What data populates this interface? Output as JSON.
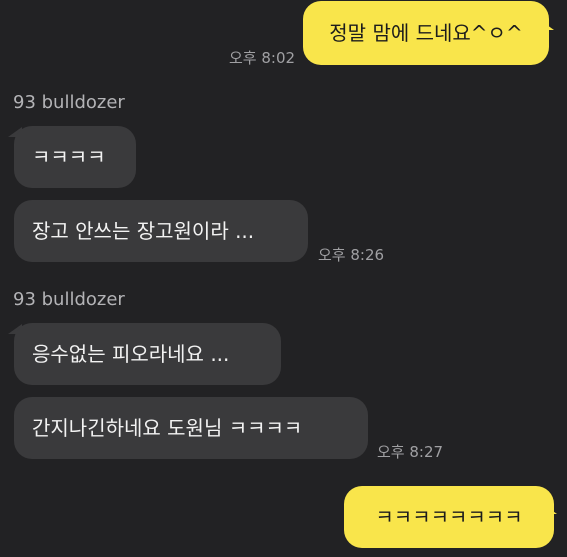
{
  "messages": [
    {
      "direction": "outgoing",
      "text": "정말 맘에 드네요^ㅇ^",
      "time": "오후 8:02"
    },
    {
      "direction": "incoming",
      "sender": "93 bulldozer",
      "text": "ㅋㅋㅋㅋ"
    },
    {
      "direction": "incoming",
      "text": "장고 안쓰는 장고원이라 ...",
      "time": "오후 8:26"
    },
    {
      "direction": "incoming",
      "sender": "93 bulldozer",
      "text": "응수없는 피오라네요 ..."
    },
    {
      "direction": "incoming",
      "text": "간지나긴하네요 도원님 ㅋㅋㅋㅋ",
      "time": "오후 8:27"
    },
    {
      "direction": "outgoing",
      "text": "ㅋㅋㅋㅋㅋㅋㅋㅋ"
    }
  ],
  "colors": {
    "background": "#222224",
    "outgoing_bubble": "#f9e54b",
    "incoming_bubble": "#3a3a3c",
    "timestamp": "#a0a0a3"
  }
}
